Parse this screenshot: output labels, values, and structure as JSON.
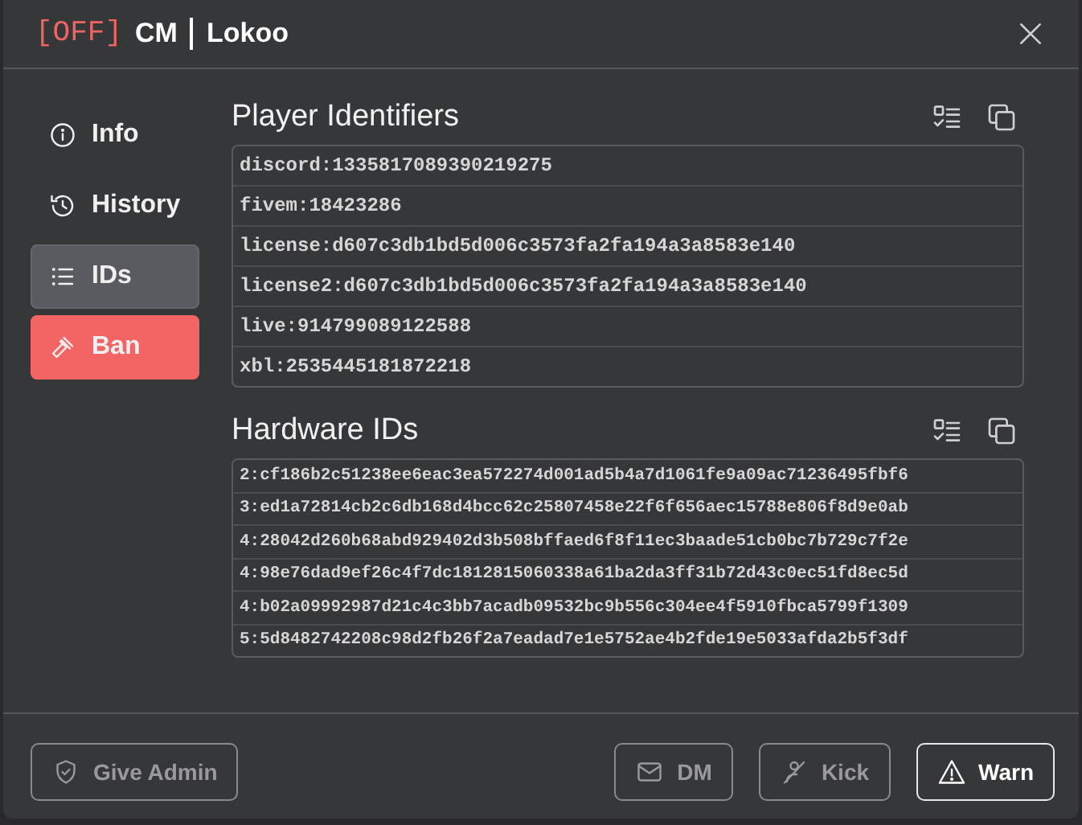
{
  "header": {
    "status": "[OFF]",
    "name": "CM",
    "player": "Lokoo"
  },
  "nav": [
    {
      "label": "Info",
      "selected": false,
      "kind": "normal"
    },
    {
      "label": "History",
      "selected": false,
      "kind": "normal"
    },
    {
      "label": "IDs",
      "selected": true,
      "kind": "normal"
    },
    {
      "label": "Ban",
      "selected": false,
      "kind": "danger"
    }
  ],
  "sections": [
    {
      "title": "Player Identifiers",
      "rows": [
        "discord:1335817089390219275",
        "fivem:18423286",
        "license:d607c3db1bd5d006c3573fa2fa194a3a8583e140",
        "license2:d607c3db1bd5d006c3573fa2fa194a3a8583e140",
        "live:914799089122588",
        "xbl:2535445181872218"
      ]
    },
    {
      "title": "Hardware IDs",
      "rows": [
        "2:cf186b2c51238ee6eac3ea572274d001ad5b4a7d1061fe9a09ac71236495fbf6",
        "3:ed1a72814cb2c6db168d4bcc62c25807458e22f6f656aec15788e806f8d9e0ab",
        "4:28042d260b68abd929402d3b508bffaed6f8f11ec3baade51cb0bc7b729c7f2e",
        "4:98e76dad9ef26c4f7dc1812815060338a61ba2da3ff31b72d43c0ec51fd8ec5d",
        "4:b02a09992987d21c4c3bb7acadb09532bc9b556c304ee4f5910fbca5799f1309",
        "5:5d8482742208c98d2fb26f2a7eadad7e1e5752ae4b2fde19e5033afda2b5f3df"
      ]
    }
  ],
  "actions": [
    {
      "label": "Give Admin",
      "disabled": true
    },
    {
      "label": "DM",
      "disabled": true
    },
    {
      "label": "Kick",
      "disabled": true
    },
    {
      "label": "Warn",
      "disabled": false
    }
  ]
}
